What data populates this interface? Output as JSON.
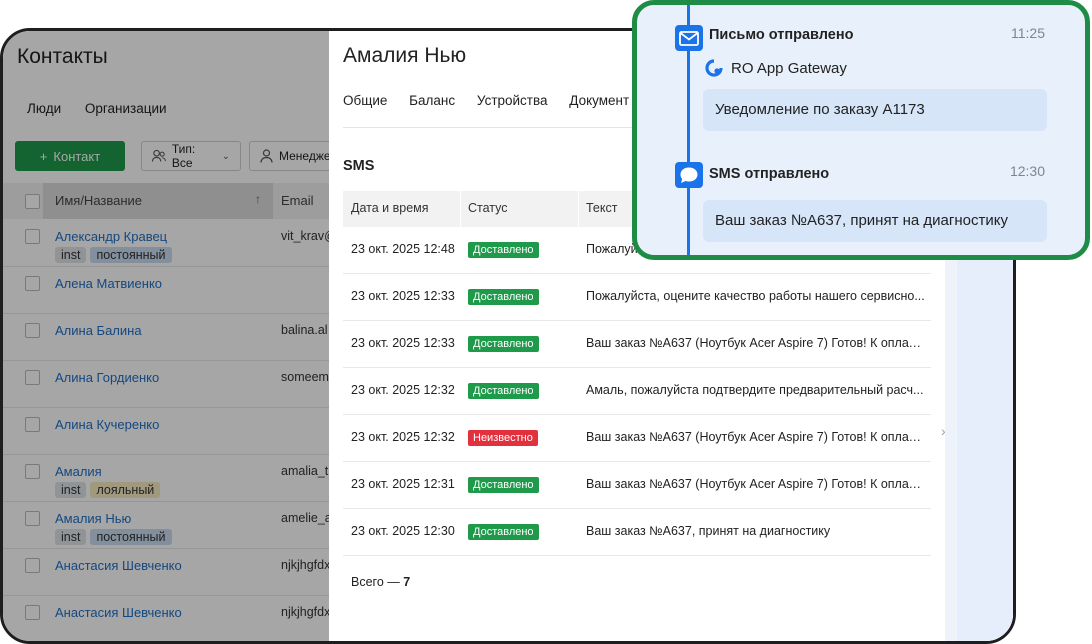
{
  "background_app": {
    "title": "Контакты",
    "subtabs": [
      "Люди",
      "Организации"
    ],
    "add_contact_label": "Контакт",
    "type_filter_label": "Тип: Все",
    "manager_filter_label": "Менедже",
    "columns": {
      "name": "Имя/Название",
      "email": "Email"
    },
    "rows": [
      {
        "name": "Александр Кравец",
        "email": "vit_krav@",
        "tags": [
          {
            "label": "inst",
            "style": "gray"
          },
          {
            "label": "постоянный",
            "style": "blue"
          }
        ]
      },
      {
        "name": "Алена Матвиенко",
        "email": "",
        "tags": []
      },
      {
        "name": "Алина Балина",
        "email": "balina.al",
        "tags": []
      },
      {
        "name": "Алина Гордиенко",
        "email": "someem",
        "tags": []
      },
      {
        "name": "Алина Кучеренко",
        "email": "",
        "tags": []
      },
      {
        "name": "Амалия",
        "email": "amalia_t",
        "tags": [
          {
            "label": "inst",
            "style": "gray"
          },
          {
            "label": "лояльный",
            "style": "yellow"
          }
        ]
      },
      {
        "name": "Амалия Нью",
        "email": "amelie_a",
        "tags": [
          {
            "label": "inst",
            "style": "gray"
          },
          {
            "label": "постоянный",
            "style": "blue"
          }
        ]
      },
      {
        "name": "Анастасия Шевченко",
        "email": "njkjhgfdx",
        "tags": []
      },
      {
        "name": "Анастасия Шевченко",
        "email": "njkjhgfdx",
        "tags": []
      }
    ]
  },
  "drawer": {
    "title": "Амалия Нью",
    "tabs": [
      "Общие",
      "Баланс",
      "Устройства",
      "Документ"
    ],
    "sms_section_title": "SMS",
    "columns": {
      "date": "Дата и время",
      "status": "Статус",
      "text": "Текст"
    },
    "rows": [
      {
        "date": "23 окт. 2025 12:48",
        "status": "Доставлено",
        "status_kind": "ok",
        "text": "Пожалуй"
      },
      {
        "date": "23 окт. 2025 12:33",
        "status": "Доставлено",
        "status_kind": "ok",
        "text": "Пожалуйста, оцените качество работы нашего сервисно..."
      },
      {
        "date": "23 окт. 2025 12:33",
        "status": "Доставлено",
        "status_kind": "ok",
        "text": "Ваш заказ №A637 (Ноутбук Acer Aspire 7) Готов! К оплате..."
      },
      {
        "date": "23 окт. 2025 12:32",
        "status": "Доставлено",
        "status_kind": "ok",
        "text": "Амаль, пожалуйста подтвердите предварительный расч..."
      },
      {
        "date": "23 окт. 2025 12:32",
        "status": "Неизвестно",
        "status_kind": "unknown",
        "text": "Ваш заказ №A637 (Ноутбук Acer Aspire 7) Готов! К оплате..."
      },
      {
        "date": "23 окт. 2025 12:31",
        "status": "Доставлено",
        "status_kind": "ok",
        "text": "Ваш заказ №A637 (Ноутбук Acer Aspire 7) Готов! К оплате..."
      },
      {
        "date": "23 окт. 2025 12:30",
        "status": "Доставлено",
        "status_kind": "ok",
        "text": "Ваш заказ №A637, принят на диагностику"
      }
    ],
    "total_label": "Всего — ",
    "total_count": "7"
  },
  "timeline": {
    "events": [
      {
        "icon": "mail-icon",
        "title": "Письмо отправлено",
        "time": "11:25",
        "sender": "RO App Gateway",
        "message": "Уведомление по заказу A1173"
      },
      {
        "icon": "chat-bubble-icon",
        "title": "SMS отправлено",
        "time": "12:30",
        "message": "Ваш заказ №A637, принят на диагностику"
      }
    ]
  },
  "colors": {
    "accent_green": "#1e9a4a",
    "link_blue": "#1f6fc5",
    "timeline_blue": "#1a73e8",
    "popup_border": "#1e8c45",
    "error_red": "#e2303d"
  }
}
